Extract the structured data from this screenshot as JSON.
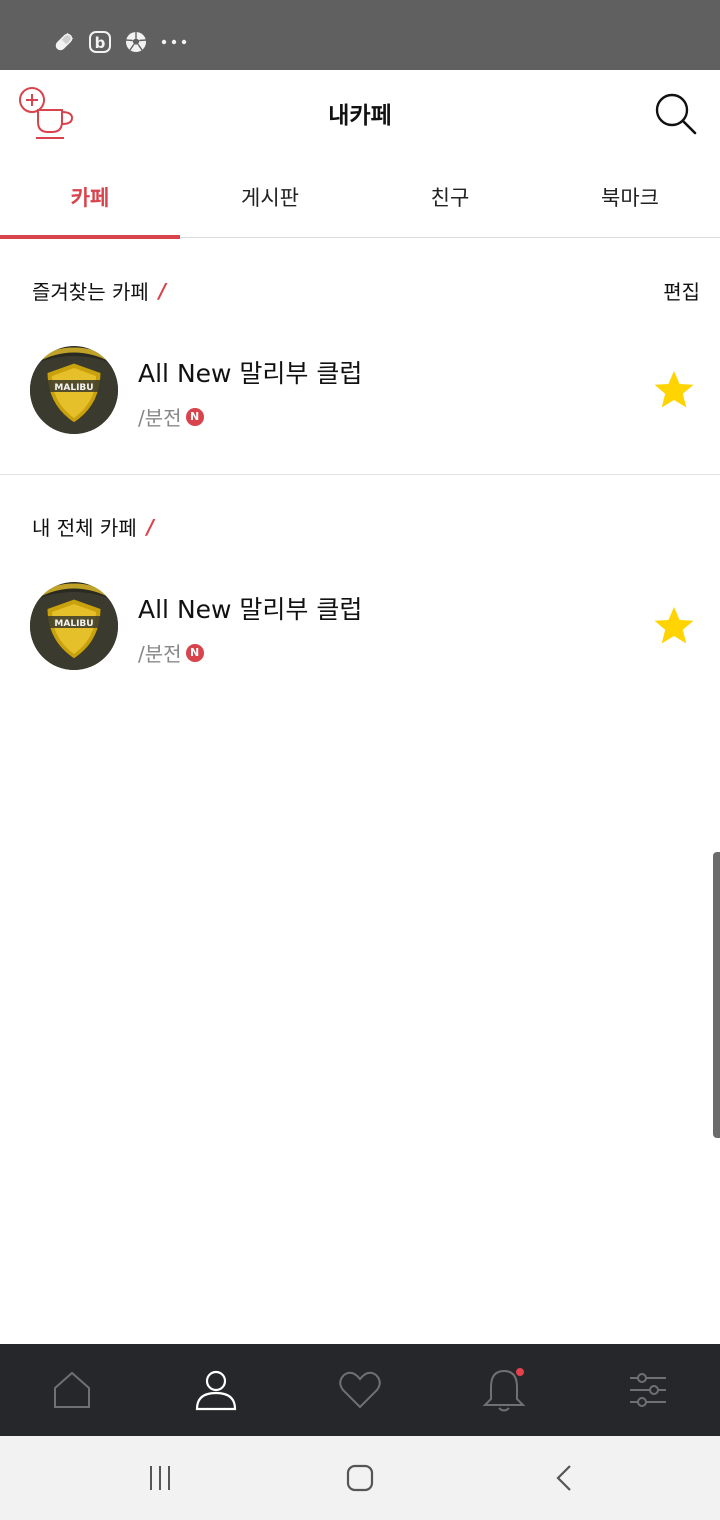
{
  "header": {
    "title": "내카페"
  },
  "tabs": [
    {
      "label": "카페",
      "active": true
    },
    {
      "label": "게시판",
      "active": false
    },
    {
      "label": "친구",
      "active": false
    },
    {
      "label": "북마크",
      "active": false
    }
  ],
  "favorites": {
    "heading": "즐겨찾는 카페",
    "edit_label": "편집",
    "items": [
      {
        "name": "All New 말리부 클럽",
        "meta": "/분전",
        "badge": "N",
        "starred": true,
        "avatar_text": "MALIBU"
      }
    ]
  },
  "all_cafes": {
    "heading": "내 전체 카페",
    "items": [
      {
        "name": "All New 말리부 클럽",
        "meta": "/분전",
        "badge": "N",
        "starred": true,
        "avatar_text": "MALIBU"
      }
    ]
  },
  "bottom_nav": [
    {
      "icon": "home-icon",
      "active": false
    },
    {
      "icon": "person-icon",
      "active": true
    },
    {
      "icon": "heart-icon",
      "active": false
    },
    {
      "icon": "bell-icon",
      "active": false,
      "has_dot": true
    },
    {
      "icon": "settings-sliders-icon",
      "active": false
    }
  ],
  "colors": {
    "accent": "#d9434c",
    "star": "#ffd400",
    "nav_bg": "#26272b",
    "status_bar": "#606060"
  }
}
